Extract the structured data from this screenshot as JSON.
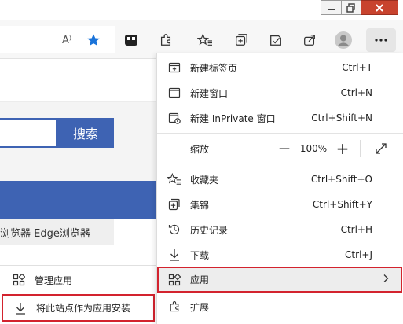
{
  "toolbar": {
    "read_aloud_label": "A⁾"
  },
  "page": {
    "search_button": "搜索",
    "tabs_text": "浏览器  Edge浏览器"
  },
  "menu": {
    "items": [
      {
        "label": "新建标签页",
        "shortcut": "Ctrl+T"
      },
      {
        "label": "新建窗口",
        "shortcut": "Ctrl+N"
      },
      {
        "label": "新建 InPrivate 窗口",
        "shortcut": "Ctrl+Shift+N"
      },
      {
        "label": "收藏夹",
        "shortcut": "Ctrl+Shift+O"
      },
      {
        "label": "集锦",
        "shortcut": "Ctrl+Shift+Y"
      },
      {
        "label": "历史记录",
        "shortcut": "Ctrl+H"
      },
      {
        "label": "下载",
        "shortcut": "Ctrl+J"
      },
      {
        "label": "应用",
        "shortcut": ""
      },
      {
        "label": "扩展",
        "shortcut": ""
      }
    ],
    "zoom": {
      "label": "缩放",
      "minus": "—",
      "value": "100%",
      "plus": "+"
    }
  },
  "submenu": {
    "items": [
      {
        "label": "管理应用"
      },
      {
        "label": "将此站点作为应用安装"
      }
    ]
  },
  "colors": {
    "accent_blue": "#3e63b3",
    "highlight_red": "#d3232e",
    "favorite_star": "#1a73d9"
  }
}
